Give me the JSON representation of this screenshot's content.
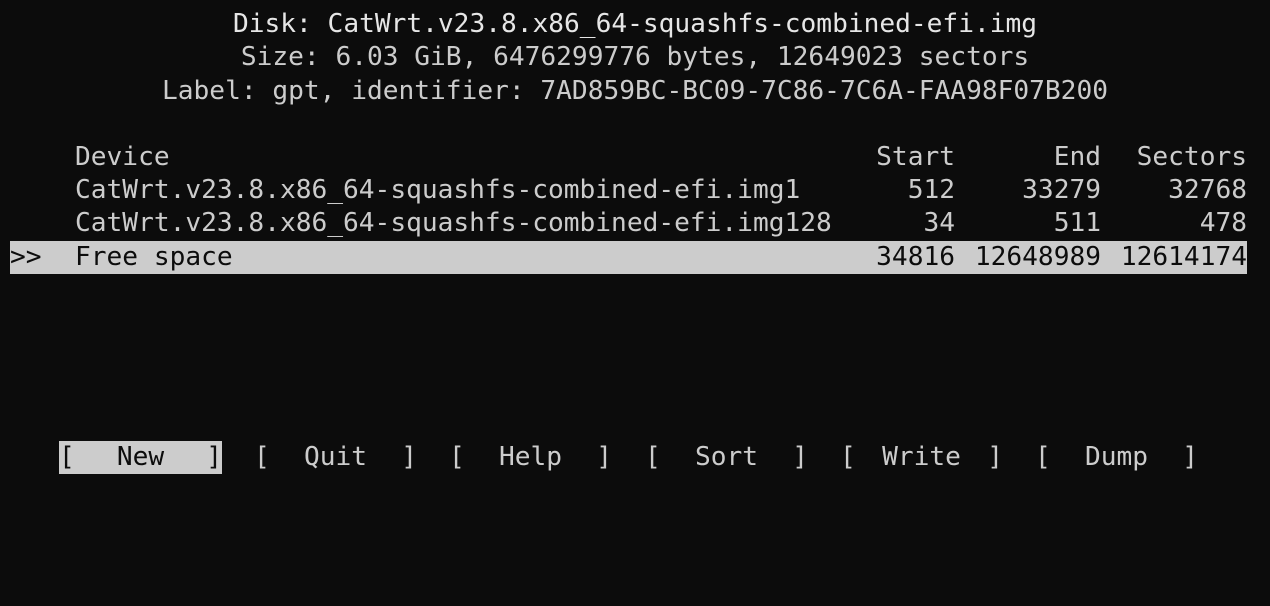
{
  "header": {
    "disk": "Disk: CatWrt.v23.8.x86_64-squashfs-combined-efi.img",
    "size": "Size: 6.03 GiB, 6476299776 bytes, 12649023 sectors",
    "label": "Label: gpt, identifier: 7AD859BC-BC09-7C86-7C6A-FAA98F07B200"
  },
  "table": {
    "columns": {
      "device": "Device",
      "start": "Start",
      "end": "End",
      "sectors": "Sectors"
    },
    "rows": [
      {
        "marker": "",
        "device": "CatWrt.v23.8.x86_64-squashfs-combined-efi.img1",
        "start": "512",
        "end": "33279",
        "sectors": "32768"
      },
      {
        "marker": "",
        "device": "CatWrt.v23.8.x86_64-squashfs-combined-efi.img128",
        "start": "34",
        "end": "511",
        "sectors": "478"
      },
      {
        "marker": ">>",
        "device": "Free space",
        "start": "34816",
        "end": "12648989",
        "sectors": "12614174"
      }
    ]
  },
  "menu": {
    "bracket_open": "[",
    "bracket_close": "]",
    "items": [
      {
        "label": "New"
      },
      {
        "label": "Quit"
      },
      {
        "label": "Help"
      },
      {
        "label": "Sort"
      },
      {
        "label": "Write"
      },
      {
        "label": "Dump"
      }
    ]
  },
  "colors": {
    "background": "#0c0c0c",
    "foreground": "#cccccc",
    "highlight_bg": "#cccccc",
    "highlight_fg": "#0c0c0c"
  }
}
